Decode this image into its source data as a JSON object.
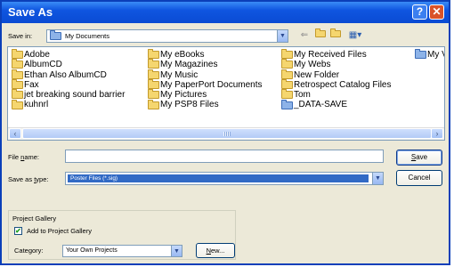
{
  "window": {
    "title": "Save As",
    "help_glyph": "?",
    "close_glyph": "✕"
  },
  "toolbar": {
    "save_in_label": "Save in:",
    "save_in_value": "My Documents",
    "back_icon": "back-arrow-icon",
    "up_icon": "up-folder-icon",
    "new_folder_icon": "new-folder-icon",
    "views_icon": "views-menu-icon"
  },
  "file_list": {
    "columns": [
      [
        {
          "name": "Adobe",
          "icon": "folder"
        },
        {
          "name": "AlbumCD",
          "icon": "folder"
        },
        {
          "name": "Ethan Also AlbumCD",
          "icon": "folder"
        },
        {
          "name": "Fax",
          "icon": "folder"
        },
        {
          "name": "jet breaking sound barrier",
          "icon": "folder"
        },
        {
          "name": "kuhnrl",
          "icon": "folder"
        }
      ],
      [
        {
          "name": "My eBooks",
          "icon": "folder"
        },
        {
          "name": "My Magazines",
          "icon": "folder"
        },
        {
          "name": "My Music",
          "icon": "music-folder"
        },
        {
          "name": "My PaperPort Documents",
          "icon": "folder"
        },
        {
          "name": "My Pictures",
          "icon": "pictures-folder"
        },
        {
          "name": "My PSP8 Files",
          "icon": "folder"
        }
      ],
      [
        {
          "name": "My Received Files",
          "icon": "folder"
        },
        {
          "name": "My Webs",
          "icon": "folder"
        },
        {
          "name": "New Folder",
          "icon": "folder"
        },
        {
          "name": "Retrospect Catalog Files",
          "icon": "folder"
        },
        {
          "name": "Tom",
          "icon": "folder"
        },
        {
          "name": "_DATA-SAVE",
          "icon": "shared-folder"
        }
      ],
      [
        {
          "name": "My V",
          "icon": "special-folder"
        }
      ]
    ]
  },
  "form": {
    "file_name_label_pre": "File ",
    "file_name_label_u": "n",
    "file_name_label_post": "ame:",
    "file_name_value": "",
    "save_type_label_pre": "Save as ",
    "save_type_label_u": "t",
    "save_type_label_post": "ype:",
    "save_type_value": "Poster Files (*.sig)",
    "save_button": "Save",
    "save_button_u": "S",
    "save_button_rest": "ave",
    "cancel_button": "Cancel"
  },
  "gallery": {
    "group_label": "Project Gallery",
    "add_label": "Add to Project Gallery",
    "add_checked": true,
    "check_glyph": "✔",
    "category_label": "Category:",
    "category_value": "Your Own Projects",
    "new_button_u": "N",
    "new_button_rest": "ew..."
  },
  "colors": {
    "title_bar": "#0a4bd3",
    "selection": "#316ac5",
    "dialog_bg": "#ece9d8"
  }
}
